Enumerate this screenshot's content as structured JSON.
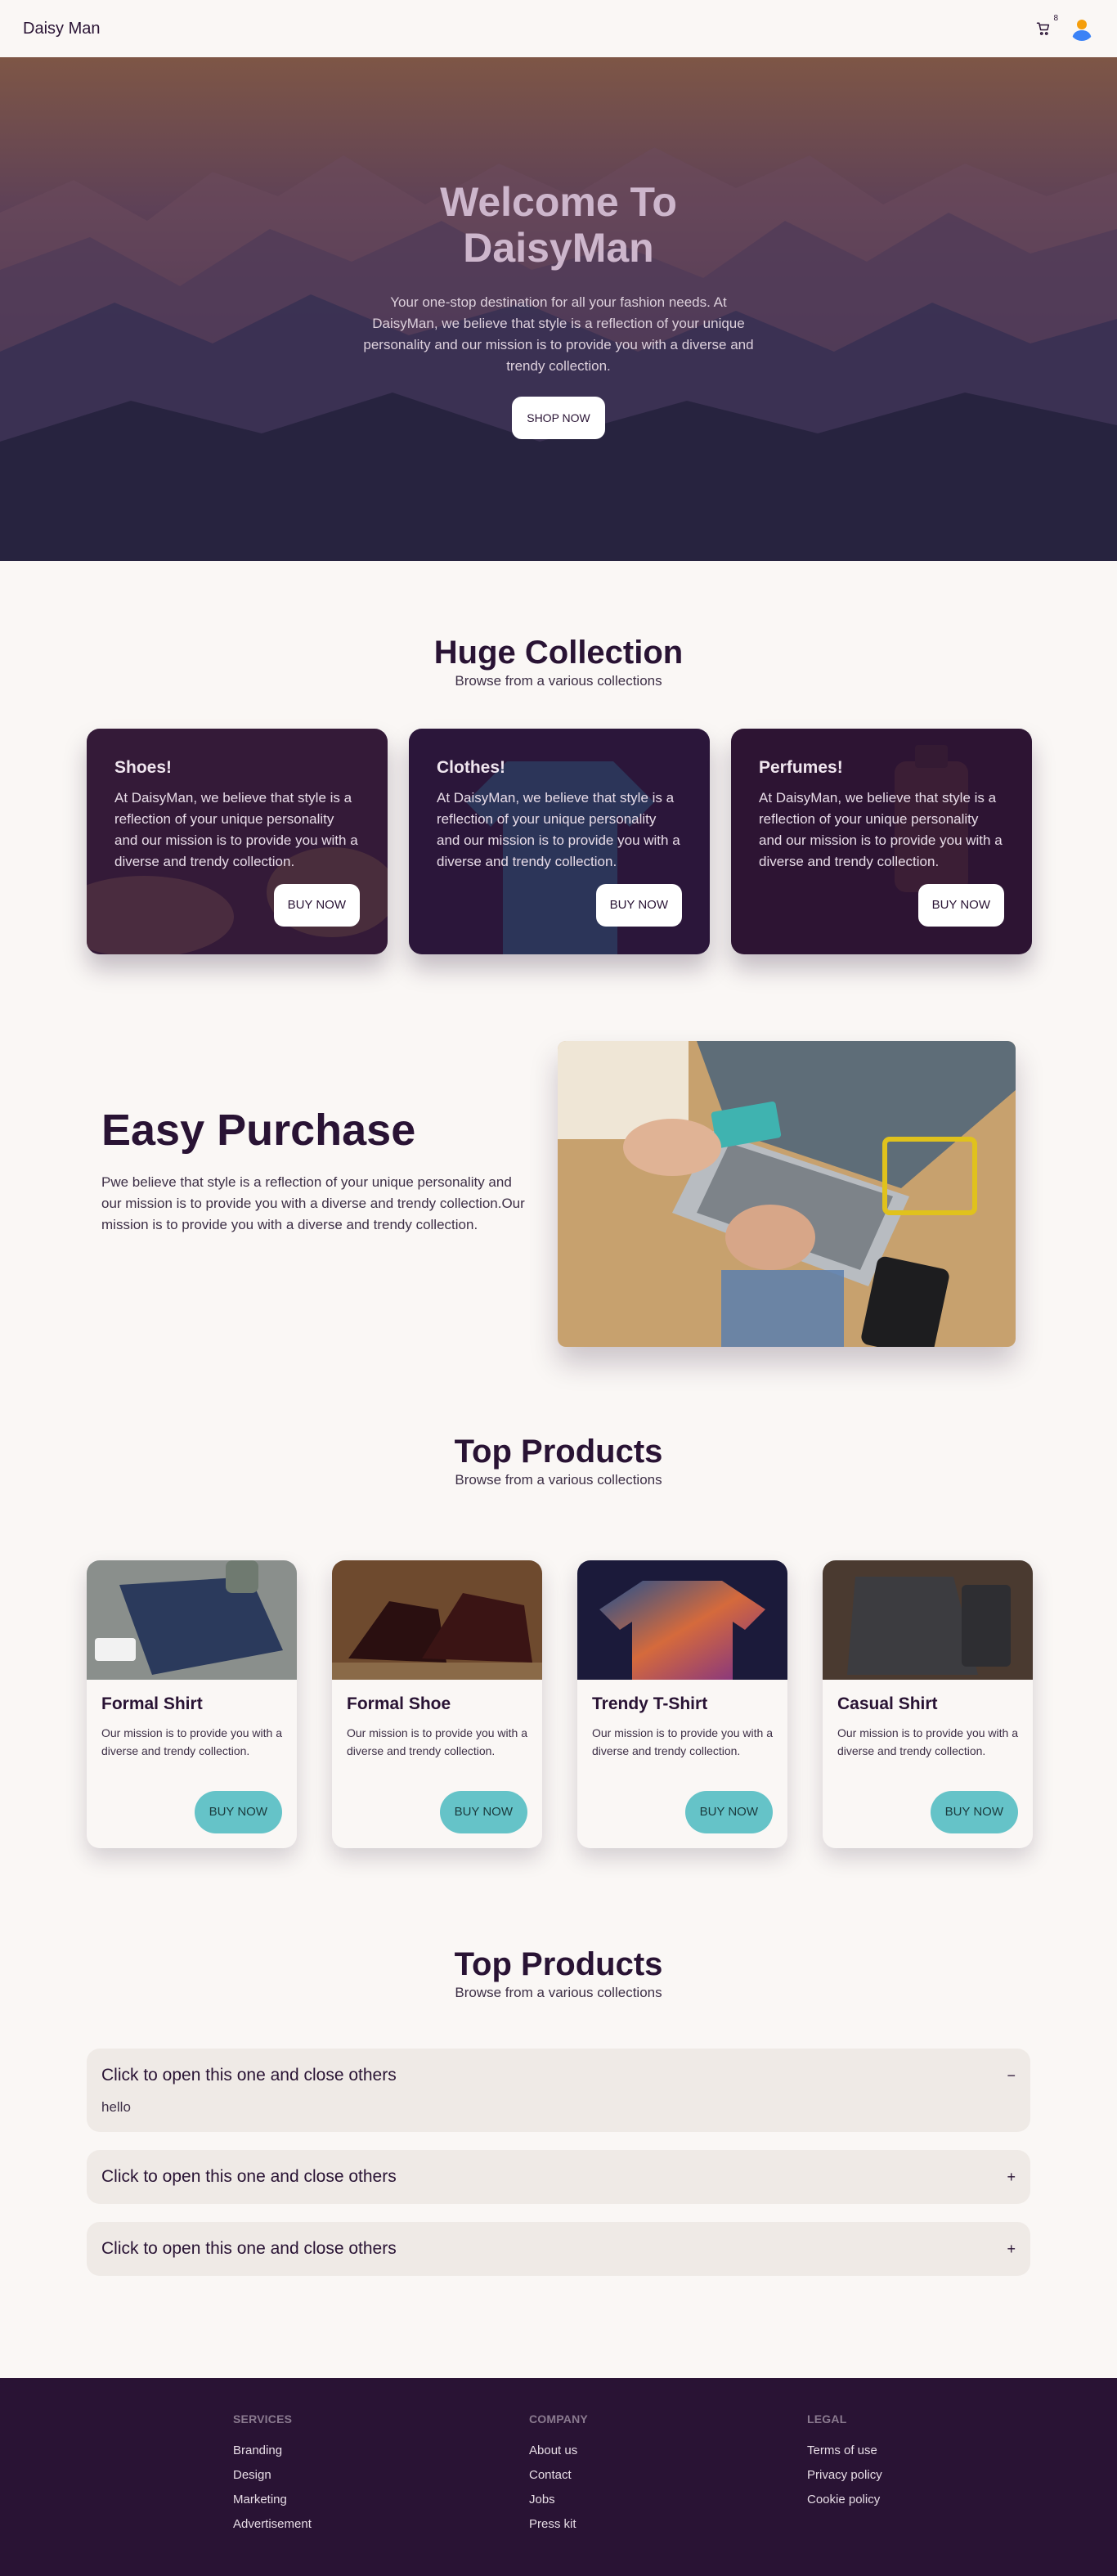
{
  "navbar": {
    "brand": "Daisy Man",
    "cart_count": "8"
  },
  "hero": {
    "title_line1": "Welcome To",
    "title_line2": "DaisyMan",
    "text": "Your one-stop destination for all your fashion needs. At DaisyMan, we believe that style is a reflection of your unique personality and our mission is to provide you with a diverse and trendy collection.",
    "button": "SHOP NOW"
  },
  "collection": {
    "title": "Huge Collection",
    "subtitle": "Browse from a various collections",
    "cards": [
      {
        "title": "Shoes!",
        "text": "At DaisyMan, we believe that style is a reflection of your unique personality and our mission is to provide you with a diverse and trendy collection.",
        "button": "BUY NOW"
      },
      {
        "title": "Clothes!",
        "text": "At DaisyMan, we believe that style is a reflection of your unique personality and our mission is to provide you with a diverse and trendy collection.",
        "button": "BUY NOW"
      },
      {
        "title": "Perfumes!",
        "text": "At DaisyMan, we believe that style is a reflection of your unique personality and our mission is to provide you with a diverse and trendy collection.",
        "button": "BUY NOW"
      }
    ]
  },
  "easy": {
    "title": "Easy Purchase",
    "text": "Pwe believe that style is a reflection of your unique personality and our mission is to provide you with a diverse and trendy collection.Our mission is to provide you with a diverse and trendy collection."
  },
  "top_products": {
    "title": "Top Products",
    "subtitle": "Browse from a various collections",
    "items": [
      {
        "title": "Formal Shirt",
        "text": "Our mission is to provide you with a diverse and trendy collection.",
        "button": "BUY NOW"
      },
      {
        "title": "Formal Shoe",
        "text": "Our mission is to provide you with a diverse and trendy collection.",
        "button": "BUY NOW"
      },
      {
        "title": "Trendy T-Shirt",
        "text": "Our mission is to provide you with a diverse and trendy collection.",
        "button": "BUY NOW"
      },
      {
        "title": "Casual Shirt",
        "text": "Our mission is to provide you with a diverse and trendy collection.",
        "button": "BUY NOW"
      }
    ]
  },
  "accordion": {
    "title": "Top Products",
    "subtitle": "Browse from a various collections",
    "items": [
      {
        "title": "Click to open this one and close others",
        "sign": "−",
        "content": "hello"
      },
      {
        "title": "Click to open this one and close others",
        "sign": "+"
      },
      {
        "title": "Click to open this one and close others",
        "sign": "+"
      }
    ]
  },
  "footer": {
    "services": {
      "heading": "SERVICES",
      "links": [
        "Branding",
        "Design",
        "Marketing",
        "Advertisement"
      ]
    },
    "company": {
      "heading": "COMPANY",
      "links": [
        "About us",
        "Contact",
        "Jobs",
        "Press kit"
      ]
    },
    "legal": {
      "heading": "LEGAL",
      "links": [
        "Terms of use",
        "Privacy policy",
        "Cookie policy"
      ]
    }
  },
  "colors": {
    "primary": "#291334",
    "accent": "#65c3c8",
    "background": "#faf7f5",
    "card_surface": "#efeae6"
  }
}
